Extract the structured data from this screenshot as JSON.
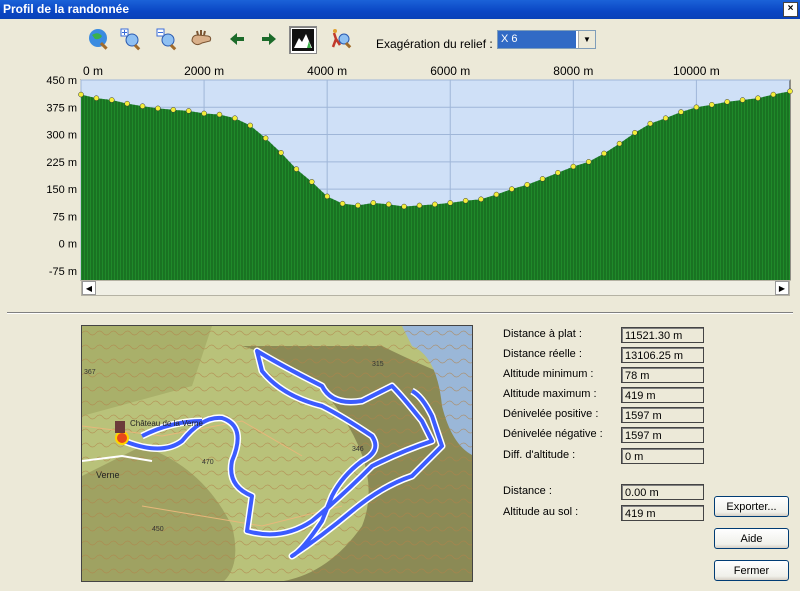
{
  "window": {
    "title": "Profil de la randonnée",
    "close": "×"
  },
  "toolbar": {
    "exaggeration_label": "Exagération du relief :",
    "exaggeration_value": "X 6"
  },
  "chart_data": {
    "type": "area",
    "xlabel": "",
    "ylabel": "",
    "x_ticks": [
      "0 m",
      "2000 m",
      "4000 m",
      "6000 m",
      "8000 m",
      "10000 m"
    ],
    "x_tick_values": [
      0,
      2000,
      4000,
      6000,
      8000,
      10000
    ],
    "y_ticks": [
      "450 m",
      "375 m",
      "300 m",
      "225 m",
      "150 m",
      "75 m",
      "0 m",
      "-75 m"
    ],
    "y_tick_values": [
      450,
      375,
      300,
      225,
      150,
      75,
      0,
      -75
    ],
    "xlim": [
      0,
      11521
    ],
    "ylim": [
      -100,
      450
    ],
    "grid": true,
    "x": [
      0,
      250,
      500,
      750,
      1000,
      1250,
      1500,
      1750,
      2000,
      2250,
      2500,
      2750,
      3000,
      3250,
      3500,
      3750,
      4000,
      4250,
      4500,
      4750,
      5000,
      5250,
      5500,
      5750,
      6000,
      6250,
      6500,
      6750,
      7000,
      7250,
      7500,
      7750,
      8000,
      8250,
      8500,
      8750,
      9000,
      9250,
      9500,
      9750,
      10000,
      10250,
      10500,
      10750,
      11000,
      11250,
      11521
    ],
    "values": [
      410,
      400,
      395,
      385,
      378,
      372,
      368,
      365,
      358,
      355,
      345,
      325,
      290,
      250,
      205,
      170,
      130,
      110,
      105,
      112,
      108,
      102,
      105,
      108,
      112,
      118,
      122,
      135,
      150,
      162,
      178,
      195,
      212,
      225,
      248,
      275,
      305,
      330,
      345,
      362,
      375,
      382,
      390,
      395,
      400,
      410,
      419
    ]
  },
  "stats": [
    {
      "label": "Distance à plat :",
      "value": "11521.30 m"
    },
    {
      "label": "Distance réelle :",
      "value": "13106.25 m"
    },
    {
      "label": "Altitude minimum :",
      "value": "78 m"
    },
    {
      "label": "Altitude maximum :",
      "value": "419 m"
    },
    {
      "label": "Dénivelée positive :",
      "value": "1597 m"
    },
    {
      "label": "Dénivelée négative :",
      "value": "1597 m"
    },
    {
      "label": "Diff. d'altitude :",
      "value": "0 m"
    }
  ],
  "cursor": [
    {
      "label": "Distance :",
      "value": "0.00 m"
    },
    {
      "label": "Altitude au sol :",
      "value": "419 m"
    }
  ],
  "buttons": {
    "export": "Exporter...",
    "help": "Aide",
    "close": "Fermer"
  },
  "map_labels": [
    "Château de la Verne",
    "Verne",
    "367",
    "315",
    "450",
    "470",
    "346"
  ],
  "colors": {
    "sky": "#cfe0f7",
    "terrain": "#1f8a2a",
    "track": "#3b5bff",
    "point": "#f3ee3a"
  }
}
